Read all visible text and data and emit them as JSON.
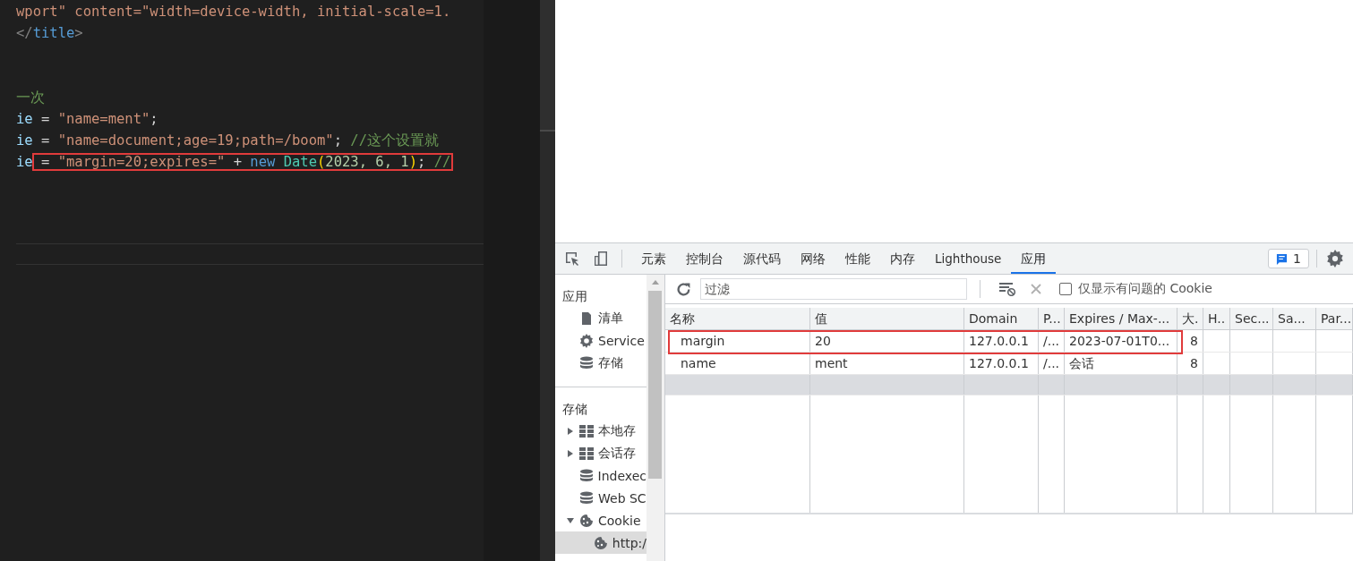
{
  "editor": {
    "blocks": [
      {
        "lines": [
          {
            "tokens": [
              {
                "text": "wport\" content=\"width=device-width, initial-scale=1.",
                "kind": "string"
              }
            ]
          },
          {
            "tokens": [
              {
                "text": "</",
                "kind": "punct"
              },
              {
                "text": "title",
                "kind": "tag"
              },
              {
                "text": ">",
                "kind": "punct"
              }
            ]
          }
        ]
      },
      {
        "lines": [
          {
            "tokens": [
              {
                "text": "一次",
                "kind": "comment"
              }
            ]
          },
          {
            "tokens": [
              {
                "text": "ie",
                "kind": "var"
              },
              {
                "text": " = ",
                "kind": "plain"
              },
              {
                "text": "\"name=ment\"",
                "kind": "string"
              },
              {
                "text": ";",
                "kind": "plain"
              }
            ]
          },
          {
            "tokens": [
              {
                "text": "ie",
                "kind": "var"
              },
              {
                "text": " = ",
                "kind": "plain"
              },
              {
                "text": "\"name=document;age=19;path=/boom\"",
                "kind": "string"
              },
              {
                "text": "; ",
                "kind": "plain"
              },
              {
                "text": "//这个设置就",
                "kind": "comment"
              }
            ]
          },
          {
            "tokens": [
              {
                "text": "ie",
                "kind": "var"
              }
            ],
            "boxed_tokens": [
              {
                "text": " = ",
                "kind": "plain"
              },
              {
                "text": "\"margin=20;expires=\"",
                "kind": "string"
              },
              {
                "text": " + ",
                "kind": "plain"
              },
              {
                "text": "new ",
                "kind": "keyword"
              },
              {
                "text": "Date",
                "kind": "class"
              },
              {
                "text": "(",
                "kind": "bracket"
              },
              {
                "text": "2023, 6, 1",
                "kind": "number"
              },
              {
                "text": ")",
                "kind": "bracket"
              },
              {
                "text": "; ",
                "kind": "plain"
              },
              {
                "text": "//",
                "kind": "comment"
              }
            ]
          }
        ]
      }
    ]
  },
  "devtools": {
    "tabs": [
      {
        "label": "元素",
        "selected": false
      },
      {
        "label": "控制台",
        "selected": false
      },
      {
        "label": "源代码",
        "selected": false
      },
      {
        "label": "网络",
        "selected": false
      },
      {
        "label": "性能",
        "selected": false
      },
      {
        "label": "内存",
        "selected": false
      },
      {
        "label": "Lighthouse",
        "selected": false
      },
      {
        "label": "应用",
        "selected": true
      }
    ],
    "issues_badge": "1",
    "sidebar": {
      "sections": [
        {
          "title": "应用",
          "items": [
            {
              "label": "清单",
              "kind": "file",
              "selected": false
            },
            {
              "label": "Service",
              "kind": "gear",
              "selected": false
            },
            {
              "label": "存储",
              "kind": "db",
              "selected": false
            }
          ]
        },
        {
          "title": "存储",
          "items": [
            {
              "label": "本地存",
              "kind": "grid",
              "expanded": false,
              "selected": false
            },
            {
              "label": "会话存",
              "kind": "grid",
              "expanded": false,
              "selected": false
            },
            {
              "label": "Indexec",
              "kind": "db",
              "selected": false
            },
            {
              "label": "Web SC",
              "kind": "db",
              "selected": false
            },
            {
              "label": "Cookie",
              "kind": "cookie",
              "expanded": true,
              "selected": false,
              "children": [
                {
                  "label": "http:/",
                  "kind": "cookie",
                  "selected": true
                }
              ]
            }
          ]
        }
      ]
    },
    "toolbar": {
      "filter_placeholder": "过滤",
      "only_issues": {
        "label": "仅显示有问题的 Cookie",
        "checked": false
      }
    },
    "table": {
      "columns": [
        "名称",
        "值",
        "Domain",
        "P...",
        "Expires / Max-...",
        "大.",
        "H..",
        "Sec...",
        "Sa...",
        "Par..."
      ],
      "rows": [
        {
          "cells": [
            "margin",
            "20",
            "127.0.0.1",
            "/...",
            "2023-07-01T0...",
            "8",
            "",
            "",
            "",
            ""
          ],
          "selected": false,
          "boxed": true
        },
        {
          "cells": [
            "name",
            "ment",
            "127.0.0.1",
            "/...",
            "会话",
            "8",
            "",
            "",
            "",
            ""
          ],
          "selected": false,
          "boxed": false
        }
      ]
    }
  }
}
